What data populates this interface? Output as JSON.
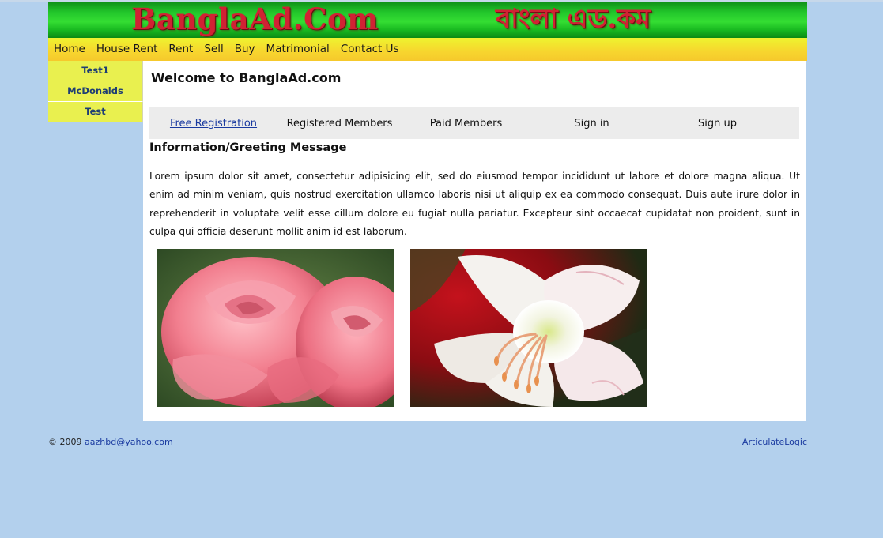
{
  "banner": {
    "title_en": "BanglaAd.Com",
    "title_bn": "বাংলা এড.কম"
  },
  "menu": [
    "Home",
    "House Rent",
    "Rent",
    "Sell",
    "Buy",
    "Matrimonial",
    "Contact Us"
  ],
  "leftnav": [
    "Test1",
    "McDonalds",
    "Test"
  ],
  "main": {
    "welcome": "Welcome to BanglaAd.com",
    "subnav": [
      "Free Registration",
      "Registered Members",
      "Paid Members",
      "Sign in",
      "Sign up"
    ],
    "section_title": "Information/Greeting Message",
    "paragraph": "Lorem ipsum dolor sit amet, consectetur adipisicing elit, sed do eiusmod tempor incididunt ut labore et dolore magna aliqua. Ut enim ad minim veniam, quis nostrud exercitation ullamco laboris nisi ut aliquip ex ea commodo consequat. Duis aute irure dolor in reprehenderit in voluptate velit esse cillum dolore eu fugiat nulla pariatur. Excepteur sint occaecat cupidatat non proident, sunt in culpa qui officia deserunt mollit anim id est laborum."
  },
  "footer": {
    "copyright": "© 2009",
    "email": "aazhbd@yahoo.com",
    "credit": "ArticulateLogic"
  },
  "colors": {
    "page_bg": "#b3d0ed",
    "banner_green": "#22c72b",
    "banner_text": "#d12233",
    "menu_yellow": "#f7d52e",
    "leftnav_bg": "#e9f04f",
    "link": "#1a3aa0"
  }
}
